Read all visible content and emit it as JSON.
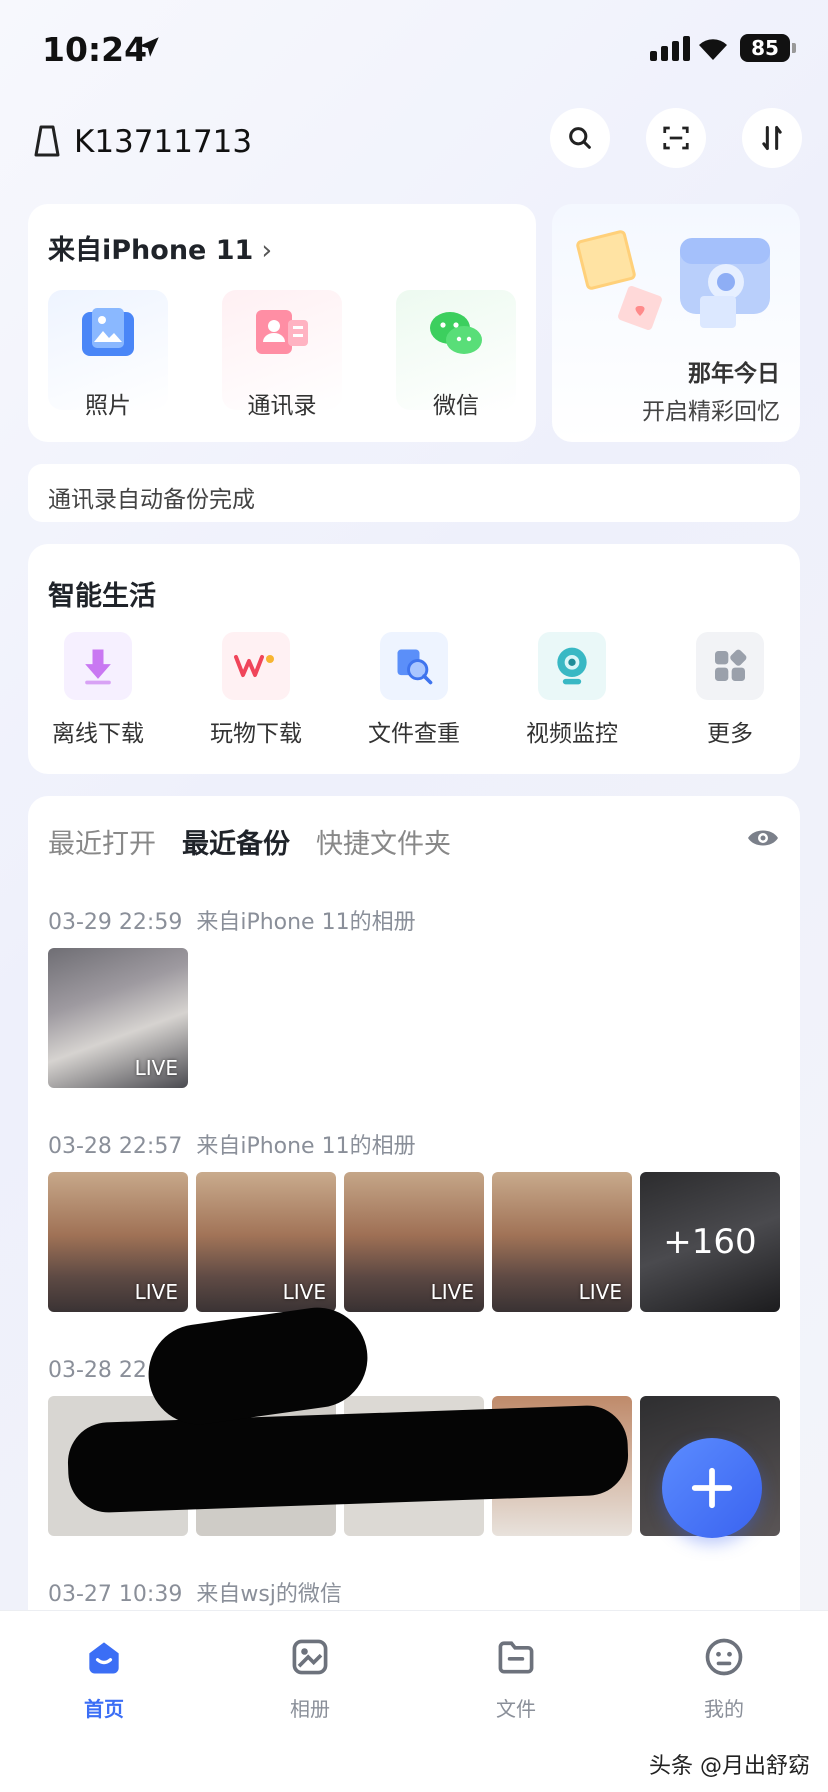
{
  "status_bar": {
    "time": "10:24",
    "battery": "85"
  },
  "header": {
    "account": "K13711713",
    "icons": [
      "search-icon",
      "scan-icon",
      "transfer-icon"
    ]
  },
  "from_device": {
    "title": "来自iPhone 11",
    "items": [
      {
        "label": "照片",
        "icon": "photo-icon"
      },
      {
        "label": "通讯录",
        "icon": "contacts-icon"
      },
      {
        "label": "微信",
        "icon": "wechat-icon"
      }
    ]
  },
  "memories": {
    "title": "那年今日",
    "subtitle": "开启精彩回忆"
  },
  "notice": {
    "text": "通讯录自动备份完成"
  },
  "smart_life": {
    "title": "智能生活",
    "tools": [
      {
        "label": "离线下载",
        "icon": "download-icon"
      },
      {
        "label": "玩物下载",
        "icon": "wanwu-icon"
      },
      {
        "label": "文件查重",
        "icon": "file-search-icon"
      },
      {
        "label": "视频监控",
        "icon": "camera-icon"
      },
      {
        "label": "更多",
        "icon": "grid-icon"
      }
    ]
  },
  "recent": {
    "tabs": [
      "最近打开",
      "最近备份",
      "快捷文件夹"
    ],
    "active_tab": "最近备份",
    "groups": [
      {
        "date": "03-29 22:59",
        "source": "来自iPhone 11的相册",
        "thumbs": [
          {
            "live": "LIVE"
          }
        ]
      },
      {
        "date": "03-28 22:57",
        "source": "来自iPhone 11的相册",
        "thumbs": [
          {
            "live": "LIVE"
          },
          {
            "live": "LIVE"
          },
          {
            "live": "LIVE"
          },
          {
            "live": "LIVE"
          }
        ],
        "more": "+160"
      },
      {
        "date": "03-28 22",
        "source": "册",
        "thumbs": []
      },
      {
        "date": "03-27 10:39",
        "source": "来自wsj的微信",
        "thumbs": []
      }
    ]
  },
  "tabbar": {
    "items": [
      {
        "label": "首页",
        "icon": "home-icon",
        "active": true
      },
      {
        "label": "相册",
        "icon": "album-icon"
      },
      {
        "label": "文件",
        "icon": "folder-icon"
      },
      {
        "label": "我的",
        "icon": "profile-icon"
      }
    ]
  },
  "watermark": "头条 @月出舒窈",
  "colors": {
    "accent": "#3b6ef5",
    "background": "#f4f5f9"
  }
}
